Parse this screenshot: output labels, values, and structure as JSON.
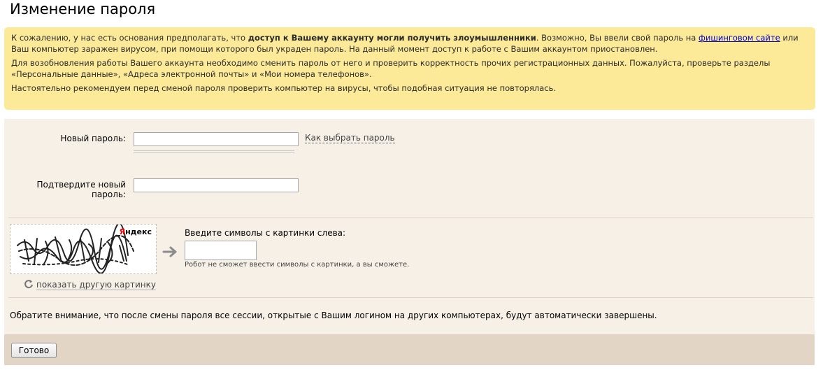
{
  "page": {
    "title": "Изменение пароля"
  },
  "warning": {
    "p1_start": "К сожалению, у нас есть основания предполагать, что ",
    "p1_bold": "доступ к Вашему аккаунту могли получить злоумышленники",
    "p1_mid": ". Возможно, Вы ввели свой пароль на ",
    "p1_link": "фишинговом сайте",
    "p1_end": " или Ваш компьютер заражен вирусом, при помощи которого был украден пароль. На данный момент доступ к работе с Вашим аккаунтом приостановлен.",
    "p2": "Для возобновления работы Вашего аккаунта необходимо сменить пароль от него и проверить корректность прочих регистрационных данных. Пожалуйста, проверьте разделы «Персональные данные», «Адреса электронной почты» и «Мои номера телефонов».",
    "p3": "Настоятельно рекомендуем перед сменой пароля проверить компьютер на вирусы, чтобы подобная ситуация не повторялась."
  },
  "form": {
    "new_password_label": "Новый пароль:",
    "new_password_value": "",
    "password_help_link": "Как выбрать пароль",
    "confirm_password_label": "Подтвердите новый пароль:",
    "confirm_password_value": ""
  },
  "captcha": {
    "brand_first": "Я",
    "brand_rest": "ндекс",
    "refresh_label": "показать другую картинку",
    "input_label": "Введите символы с картинки слева:",
    "input_value": "",
    "hint": "Робот не сможет ввести символы с картинки, а вы сможете."
  },
  "notice": "Обратите внимание, что после смены пароля все сессии, открытые с Вашим логином на других компьютерах, будут автоматически завершены.",
  "footer": {
    "submit_label": "Готово"
  },
  "colors": {
    "warning_bg": "#fcea99",
    "panel_bg": "#f6f0e7",
    "footer_bg": "#e3d5c6",
    "link": "#0000cc",
    "brand_red": "#ee0000"
  },
  "icons": [
    "arrow-right-icon",
    "refresh-icon"
  ]
}
